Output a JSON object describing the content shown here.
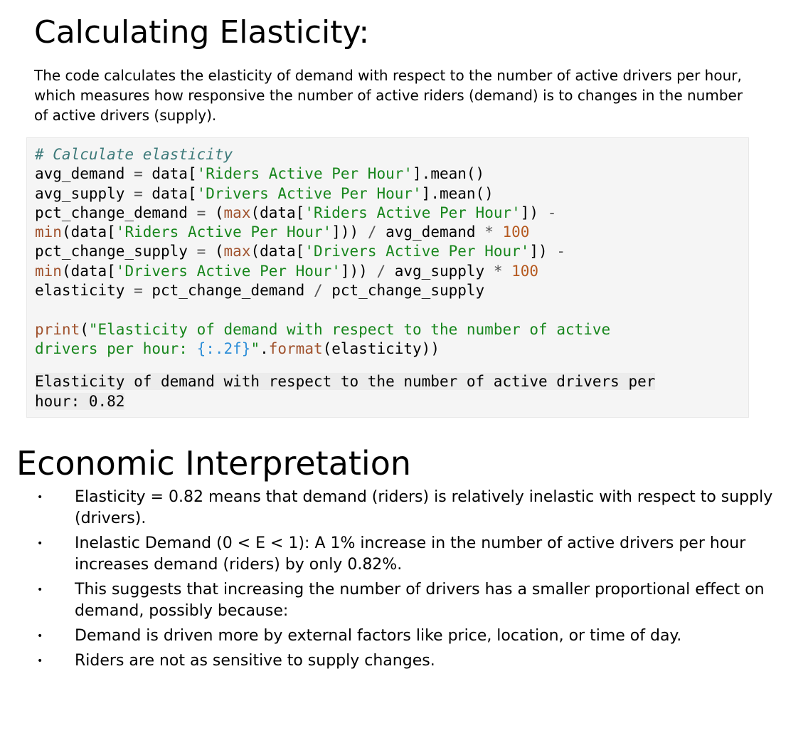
{
  "heading": "Calculating Elasticity:",
  "intro": "The code calculates the elasticity of demand with respect to the number of active drivers per hour, which measures how responsive the number of active riders (demand) is to changes in the number of active drivers (supply).",
  "code": {
    "lines": [
      [
        {
          "t": "# Calculate elasticity",
          "c": "cm"
        }
      ],
      [
        {
          "t": "avg_demand ",
          "c": ""
        },
        {
          "t": "=",
          "c": "op"
        },
        {
          "t": " data[",
          "c": ""
        },
        {
          "t": "'Riders Active Per Hour'",
          "c": "st"
        },
        {
          "t": "].mean()",
          "c": ""
        }
      ],
      [
        {
          "t": "avg_supply ",
          "c": ""
        },
        {
          "t": "=",
          "c": "op"
        },
        {
          "t": " data[",
          "c": ""
        },
        {
          "t": "'Drivers Active Per Hour'",
          "c": "st"
        },
        {
          "t": "].mean()",
          "c": ""
        }
      ],
      [
        {
          "t": "pct_change_demand ",
          "c": ""
        },
        {
          "t": "=",
          "c": "op"
        },
        {
          "t": " (",
          "c": ""
        },
        {
          "t": "max",
          "c": "bi"
        },
        {
          "t": "(data[",
          "c": ""
        },
        {
          "t": "'Riders Active Per Hour'",
          "c": "st"
        },
        {
          "t": "]) ",
          "c": ""
        },
        {
          "t": "-",
          "c": "op"
        }
      ],
      [
        {
          "t": "min",
          "c": "bi"
        },
        {
          "t": "(data[",
          "c": ""
        },
        {
          "t": "'Riders Active Per Hour'",
          "c": "st"
        },
        {
          "t": "])) ",
          "c": ""
        },
        {
          "t": "/",
          "c": "op"
        },
        {
          "t": " avg_demand ",
          "c": ""
        },
        {
          "t": "*",
          "c": "op"
        },
        {
          "t": " ",
          "c": ""
        },
        {
          "t": "100",
          "c": "nu"
        }
      ],
      [
        {
          "t": "pct_change_supply ",
          "c": ""
        },
        {
          "t": "=",
          "c": "op"
        },
        {
          "t": " (",
          "c": ""
        },
        {
          "t": "max",
          "c": "bi"
        },
        {
          "t": "(data[",
          "c": ""
        },
        {
          "t": "'Drivers Active Per Hour'",
          "c": "st"
        },
        {
          "t": "]) ",
          "c": ""
        },
        {
          "t": "-",
          "c": "op"
        }
      ],
      [
        {
          "t": "min",
          "c": "bi"
        },
        {
          "t": "(data[",
          "c": ""
        },
        {
          "t": "'Drivers Active Per Hour'",
          "c": "st"
        },
        {
          "t": "])) ",
          "c": ""
        },
        {
          "t": "/",
          "c": "op"
        },
        {
          "t": " avg_supply ",
          "c": ""
        },
        {
          "t": "*",
          "c": "op"
        },
        {
          "t": " ",
          "c": ""
        },
        {
          "t": "100",
          "c": "nu"
        }
      ],
      [
        {
          "t": "elasticity ",
          "c": ""
        },
        {
          "t": "=",
          "c": "op"
        },
        {
          "t": " pct_change_demand ",
          "c": ""
        },
        {
          "t": "/",
          "c": "op"
        },
        {
          "t": " pct_change_supply",
          "c": ""
        }
      ],
      [],
      [
        {
          "t": "print",
          "c": "bi"
        },
        {
          "t": "(",
          "c": ""
        },
        {
          "t": "\"Elasticity of demand with respect to the number of active",
          "c": "st"
        }
      ],
      [
        {
          "t": "drivers per hour: ",
          "c": "st"
        },
        {
          "t": "{:.2f}",
          "c": "fs"
        },
        {
          "t": "\"",
          "c": "st"
        },
        {
          "t": ".",
          "c": ""
        },
        {
          "t": "format",
          "c": "bi"
        },
        {
          "t": "(elasticity))",
          "c": ""
        }
      ]
    ]
  },
  "output": [
    "Elasticity of demand with respect to the number of active drivers per",
    "hour: 0.82"
  ],
  "interpretation": {
    "title": "Economic Interpretation",
    "bullet_symbol": "•",
    "items": [
      "Elasticity = 0.82 means that demand (riders) is relatively inelastic with respect to supply (drivers).",
      "Inelastic Demand (0 < E < 1): A 1% increase in the number of active drivers per hour increases demand (riders) by only 0.82%.",
      "This suggests that increasing the number of drivers has a smaller proportional effect on demand, possibly because:",
      "Demand is driven more by external factors like price, location, or time of day.",
      "Riders are not as sensitive to supply changes."
    ]
  }
}
